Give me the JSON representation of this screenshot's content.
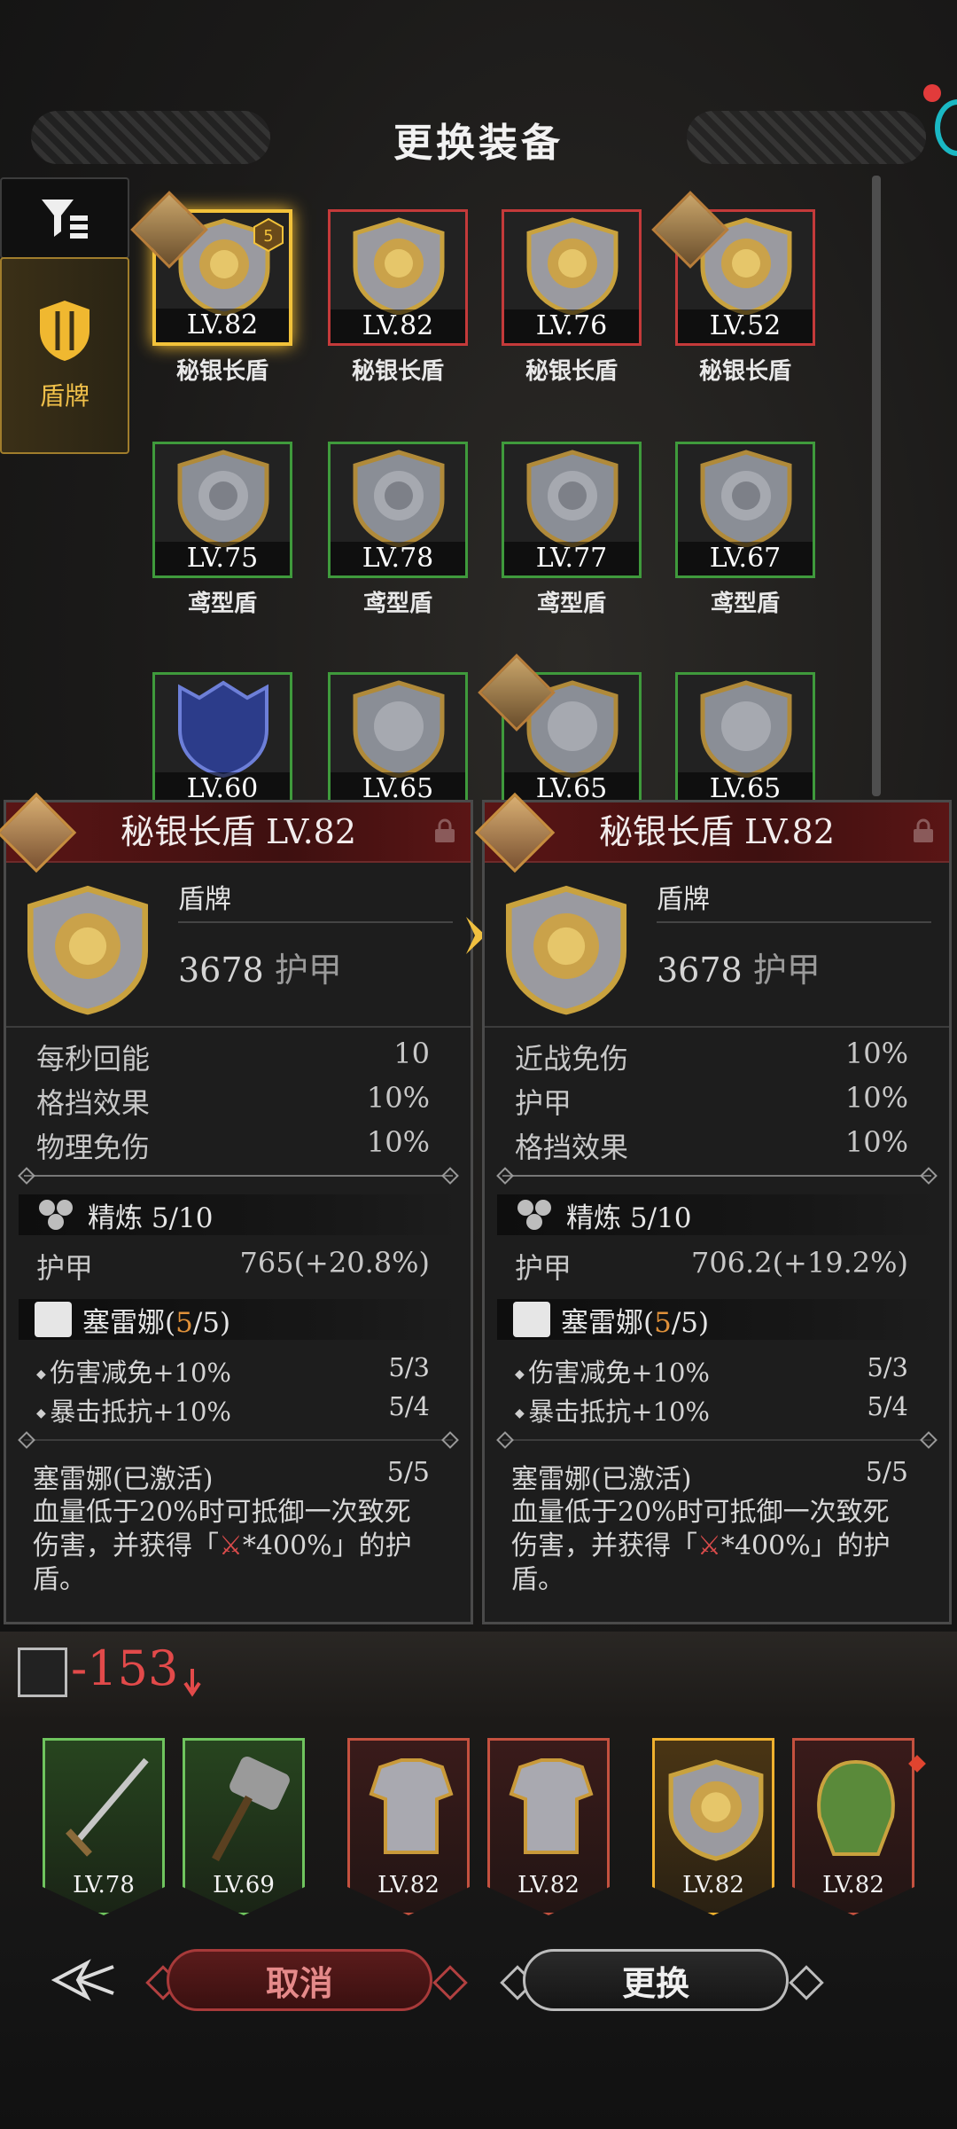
{
  "header": {
    "title": "更换装备"
  },
  "sidebar": {
    "category_label": "盾牌"
  },
  "grid": [
    {
      "level": "LV.82",
      "name": "秘银长盾",
      "rarity": "gold-selected",
      "badge": "5"
    },
    {
      "level": "LV.82",
      "name": "秘银长盾",
      "rarity": "red"
    },
    {
      "level": "LV.76",
      "name": "秘银长盾",
      "rarity": "red"
    },
    {
      "level": "LV.52",
      "name": "秘银长盾",
      "rarity": "red"
    },
    {
      "level": "LV.75",
      "name": "鸢型盾",
      "rarity": "green"
    },
    {
      "level": "LV.78",
      "name": "鸢型盾",
      "rarity": "green"
    },
    {
      "level": "LV.77",
      "name": "鸢型盾",
      "rarity": "green"
    },
    {
      "level": "LV.67",
      "name": "鸢型盾",
      "rarity": "green"
    },
    {
      "level": "LV.60",
      "name": "",
      "rarity": "green"
    },
    {
      "level": "LV.65",
      "name": "",
      "rarity": "green"
    },
    {
      "level": "LV.65",
      "name": "",
      "rarity": "green"
    },
    {
      "level": "LV.65",
      "name": "",
      "rarity": "green"
    }
  ],
  "compare": {
    "left": {
      "title": "秘银长盾 LV.82",
      "type": "盾牌",
      "armor_value": "3678",
      "armor_unit": "护甲",
      "stats": [
        {
          "label": "每秒回能",
          "value": "10"
        },
        {
          "label": "格挡效果",
          "value": "10%"
        },
        {
          "label": "物理免伤",
          "value": "10%"
        }
      ],
      "refine_label": "精炼 5/10",
      "refine_stat_label": "护甲",
      "refine_stat_value": "765(+20.8%)",
      "set_name": "塞雷娜(",
      "set_count": "5",
      "set_total": "/5)",
      "set_bonuses": [
        {
          "label": "伤害减免+10%",
          "value": "5/3"
        },
        {
          "label": "暴击抵抗+10%",
          "value": "5/4"
        }
      ],
      "set_active_label": "塞雷娜(已激活)",
      "set_active_value": "5/5",
      "desc_1": "血量低于20%时可抵御一次致死",
      "desc_2a": "伤害，并获得「",
      "desc_2icon": "⚔",
      "desc_2b": "*400%」的护",
      "desc_3": "盾。"
    },
    "right": {
      "title": "秘银长盾 LV.82",
      "type": "盾牌",
      "armor_value": "3678",
      "armor_unit": "护甲",
      "stats": [
        {
          "label": "近战免伤",
          "value": "10%"
        },
        {
          "label": "护甲",
          "value": "10%"
        },
        {
          "label": "格挡效果",
          "value": "10%"
        }
      ],
      "refine_label": "精炼 5/10",
      "refine_stat_label": "护甲",
      "refine_stat_value": "706.2(+19.2%)",
      "set_name": "塞雷娜(",
      "set_count": "5",
      "set_total": "/5)",
      "set_bonuses": [
        {
          "label": "伤害减免+10%",
          "value": "5/3"
        },
        {
          "label": "暴击抵抗+10%",
          "value": "5/4"
        }
      ],
      "set_active_label": "塞雷娜(已激活)",
      "set_active_value": "5/5",
      "desc_1": "血量低于20%时可抵御一次致死",
      "desc_2a": "伤害，并获得「",
      "desc_2icon": "⚔",
      "desc_2b": "*400%」的护",
      "desc_3": "盾。"
    }
  },
  "power_change": "-153",
  "equipped": [
    {
      "level": "LV.78",
      "kind": "sword",
      "rarity": "green"
    },
    {
      "level": "LV.69",
      "kind": "hammer",
      "rarity": "green"
    },
    {
      "level": "LV.82",
      "kind": "armor",
      "rarity": "red"
    },
    {
      "level": "LV.82",
      "kind": "armor",
      "rarity": "red"
    },
    {
      "level": "LV.82",
      "kind": "shield",
      "rarity": "gold"
    },
    {
      "level": "LV.82",
      "kind": "helm",
      "rarity": "red"
    }
  ],
  "buttons": {
    "cancel": "取消",
    "swap": "更换"
  },
  "colors": {
    "gold": "#f2c23a",
    "red_rarity": "#c43a3a",
    "green_rarity": "#3f9a3c",
    "power_down": "#e24a4a"
  }
}
